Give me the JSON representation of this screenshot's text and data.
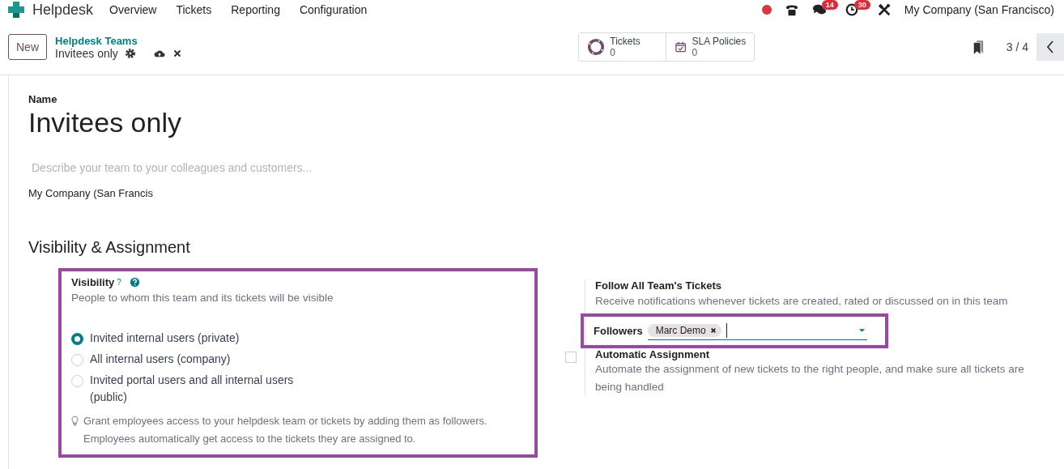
{
  "navbar": {
    "app_name": "Helpdesk",
    "menu": [
      "Overview",
      "Tickets",
      "Reporting",
      "Configuration"
    ],
    "messages_badge": "14",
    "activities_badge": "30",
    "company": "My Company (San Francisco)"
  },
  "control_panel": {
    "new_button": "New",
    "breadcrumb": "Helpdesk Teams",
    "record_name": "Invitees only",
    "smart_buttons": [
      {
        "kind": "tickets",
        "label": "Tickets",
        "value": "0"
      },
      {
        "kind": "sla",
        "label": "SLA Policies",
        "value": "0"
      }
    ],
    "pager": "3 / 4"
  },
  "form": {
    "name_label": "Name",
    "name": "Invitees only",
    "description_placeholder": "Describe your team to your colleagues and customers...",
    "company": "My Company (San Francis",
    "section_title": "Visibility & Assignment",
    "visibility": {
      "label": "Visibility",
      "tooltip_mark": "?",
      "description": "People to whom this team and its tickets will be visible",
      "options": [
        {
          "label": "Invited internal users (private)",
          "selected": true
        },
        {
          "label": "All internal users (company)",
          "selected": false
        },
        {
          "label": "Invited portal users and all internal users (public)",
          "selected": false
        }
      ],
      "hint": "Grant employees access to your helpdesk team or tickets by adding them as followers. Employees automatically get access to the tickets they are assigned to."
    },
    "follow_all": {
      "label": "Follow All Team's Tickets",
      "description": "Receive notifications whenever tickets are created, rated or discussed on in this team"
    },
    "followers": {
      "label": "Followers",
      "tags": [
        "Marc Demo"
      ]
    },
    "auto_assignment": {
      "label": "Automatic Assignment",
      "checked": false,
      "description": "Automate the assignment of new tickets to the right people, and make sure all tickets are being handled"
    }
  }
}
